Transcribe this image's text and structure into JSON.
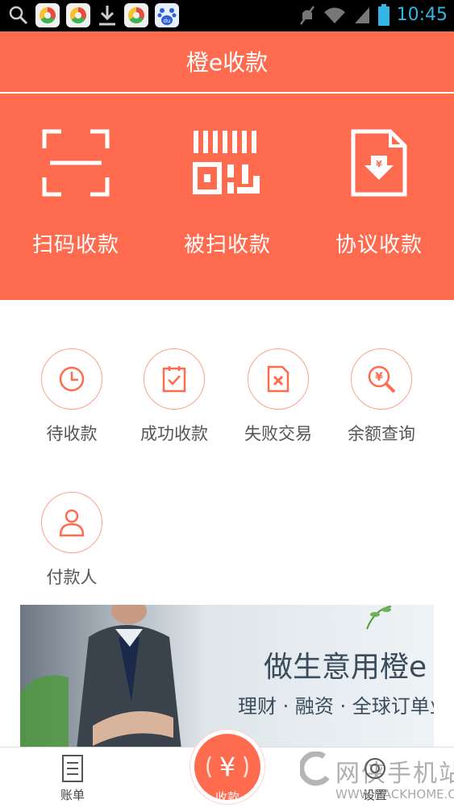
{
  "status_bar": {
    "time": "10:45",
    "icons": [
      "search-icon",
      "app-icon",
      "app-icon",
      "download-icon",
      "app-icon",
      "baidu-icon",
      "mute-icon",
      "wifi-icon",
      "signal-icon",
      "battery-icon"
    ]
  },
  "header": {
    "title": "橙e收款",
    "quick_actions": [
      {
        "label": "扫码收款",
        "icon": "scan-frame-icon"
      },
      {
        "label": "被扫收款",
        "icon": "barcode-icon"
      },
      {
        "label": "协议收款",
        "icon": "document-download-icon"
      }
    ]
  },
  "functions": [
    {
      "label": "待收款",
      "icon": "clock-icon"
    },
    {
      "label": "成功收款",
      "icon": "checked-doc-icon"
    },
    {
      "label": "失败交易",
      "icon": "failed-doc-icon"
    },
    {
      "label": "余额查询",
      "icon": "yuan-search-icon"
    },
    {
      "label": "付款人",
      "icon": "person-icon"
    }
  ],
  "banner": {
    "headline": "做生意用橙e",
    "subline": "理财 · 融资 · 全球订单业务"
  },
  "tab_bar": {
    "tabs": [
      {
        "label": "账单",
        "icon": "bill-icon"
      },
      {
        "label": "收款",
        "icon": "yuan-icon"
      },
      {
        "label": "设置",
        "icon": "settings-icon"
      }
    ]
  },
  "watermark": {
    "text": "网侠手机站",
    "url": "WWW.HACKHOME.COM"
  },
  "colors": {
    "brand_orange": "#ff6b4e",
    "status_time": "#33b5e5"
  }
}
